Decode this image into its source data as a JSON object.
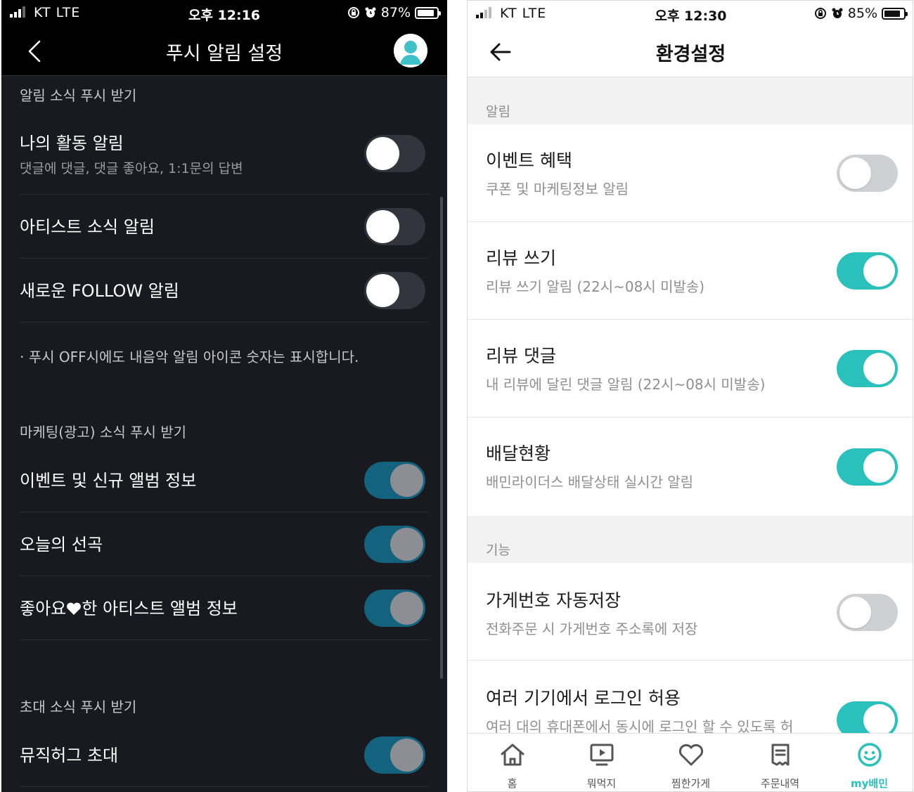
{
  "left": {
    "status": {
      "carrier": "KT  LTE",
      "time": "오후 12:16",
      "battery": "87%",
      "battery_level": 0.87
    },
    "header": {
      "title": "푸시 알림 설정"
    },
    "sections": {
      "push": "알림 소식 푸시 받기",
      "marketing": "마케팅(광고) 소식 푸시 받기",
      "invite": "초대 소식 푸시 받기"
    },
    "rows": [
      {
        "label": "나의 활동 알림",
        "sub": "댓글에 댓글, 댓글 좋아요, 1:1문의 답변",
        "on": false
      },
      {
        "label": "아티스트 소식 알림",
        "on": false
      },
      {
        "label": "새로운 FOLLOW 알림",
        "on": false
      },
      {
        "label": "이벤트 및 신규 앨범 정보",
        "on": true
      },
      {
        "label": "오늘의 선곡",
        "on": true
      },
      {
        "label_before": "좋아요",
        "label_after": "한 아티스트 앨범 정보",
        "on": true
      },
      {
        "label": "뮤직허그 초대",
        "on": true
      }
    ],
    "note": "· 푸시 OFF시에도 내음악 알림 아이콘 숫자는 표시합니다."
  },
  "right": {
    "status": {
      "carrier": "KT  LTE",
      "time": "오후 12:30",
      "battery": "85%",
      "battery_level": 0.85
    },
    "header": {
      "title": "환경설정"
    },
    "sections": {
      "alerts": "알림",
      "features": "기능"
    },
    "rows": [
      {
        "label": "이벤트 혜택",
        "sub": "쿠폰 및 마케팅정보 알림",
        "on": false
      },
      {
        "label": "리뷰 쓰기",
        "sub": "리뷰 쓰기 알림 (22시~08시 미발송)",
        "on": true
      },
      {
        "label": "리뷰 댓글",
        "sub": "내 리뷰에 달린 댓글 알림 (22시~08시 미발송)",
        "on": true
      },
      {
        "label": "배달현황",
        "sub": "배민라이더스 배달상태 실시간 알림",
        "on": true
      },
      {
        "label": "가게번호 자동저장",
        "sub": "전화주문 시 가게번호 주소록에 저장",
        "on": false
      },
      {
        "label": "여러 기기에서 로그인 허용",
        "sub": "여러 대의 휴대폰에서 동시에 로그인 할 수 있도록 허",
        "on": true
      }
    ],
    "tabs": [
      {
        "label": "홈",
        "icon": "home-icon"
      },
      {
        "label": "뭐먹지",
        "icon": "play-screen-icon"
      },
      {
        "label": "찜한가게",
        "icon": "heart-icon"
      },
      {
        "label": "주문내역",
        "icon": "receipt-icon"
      },
      {
        "label": "my배민",
        "icon": "smiley-icon",
        "active": true
      }
    ],
    "accent": "#2ac1bc"
  }
}
